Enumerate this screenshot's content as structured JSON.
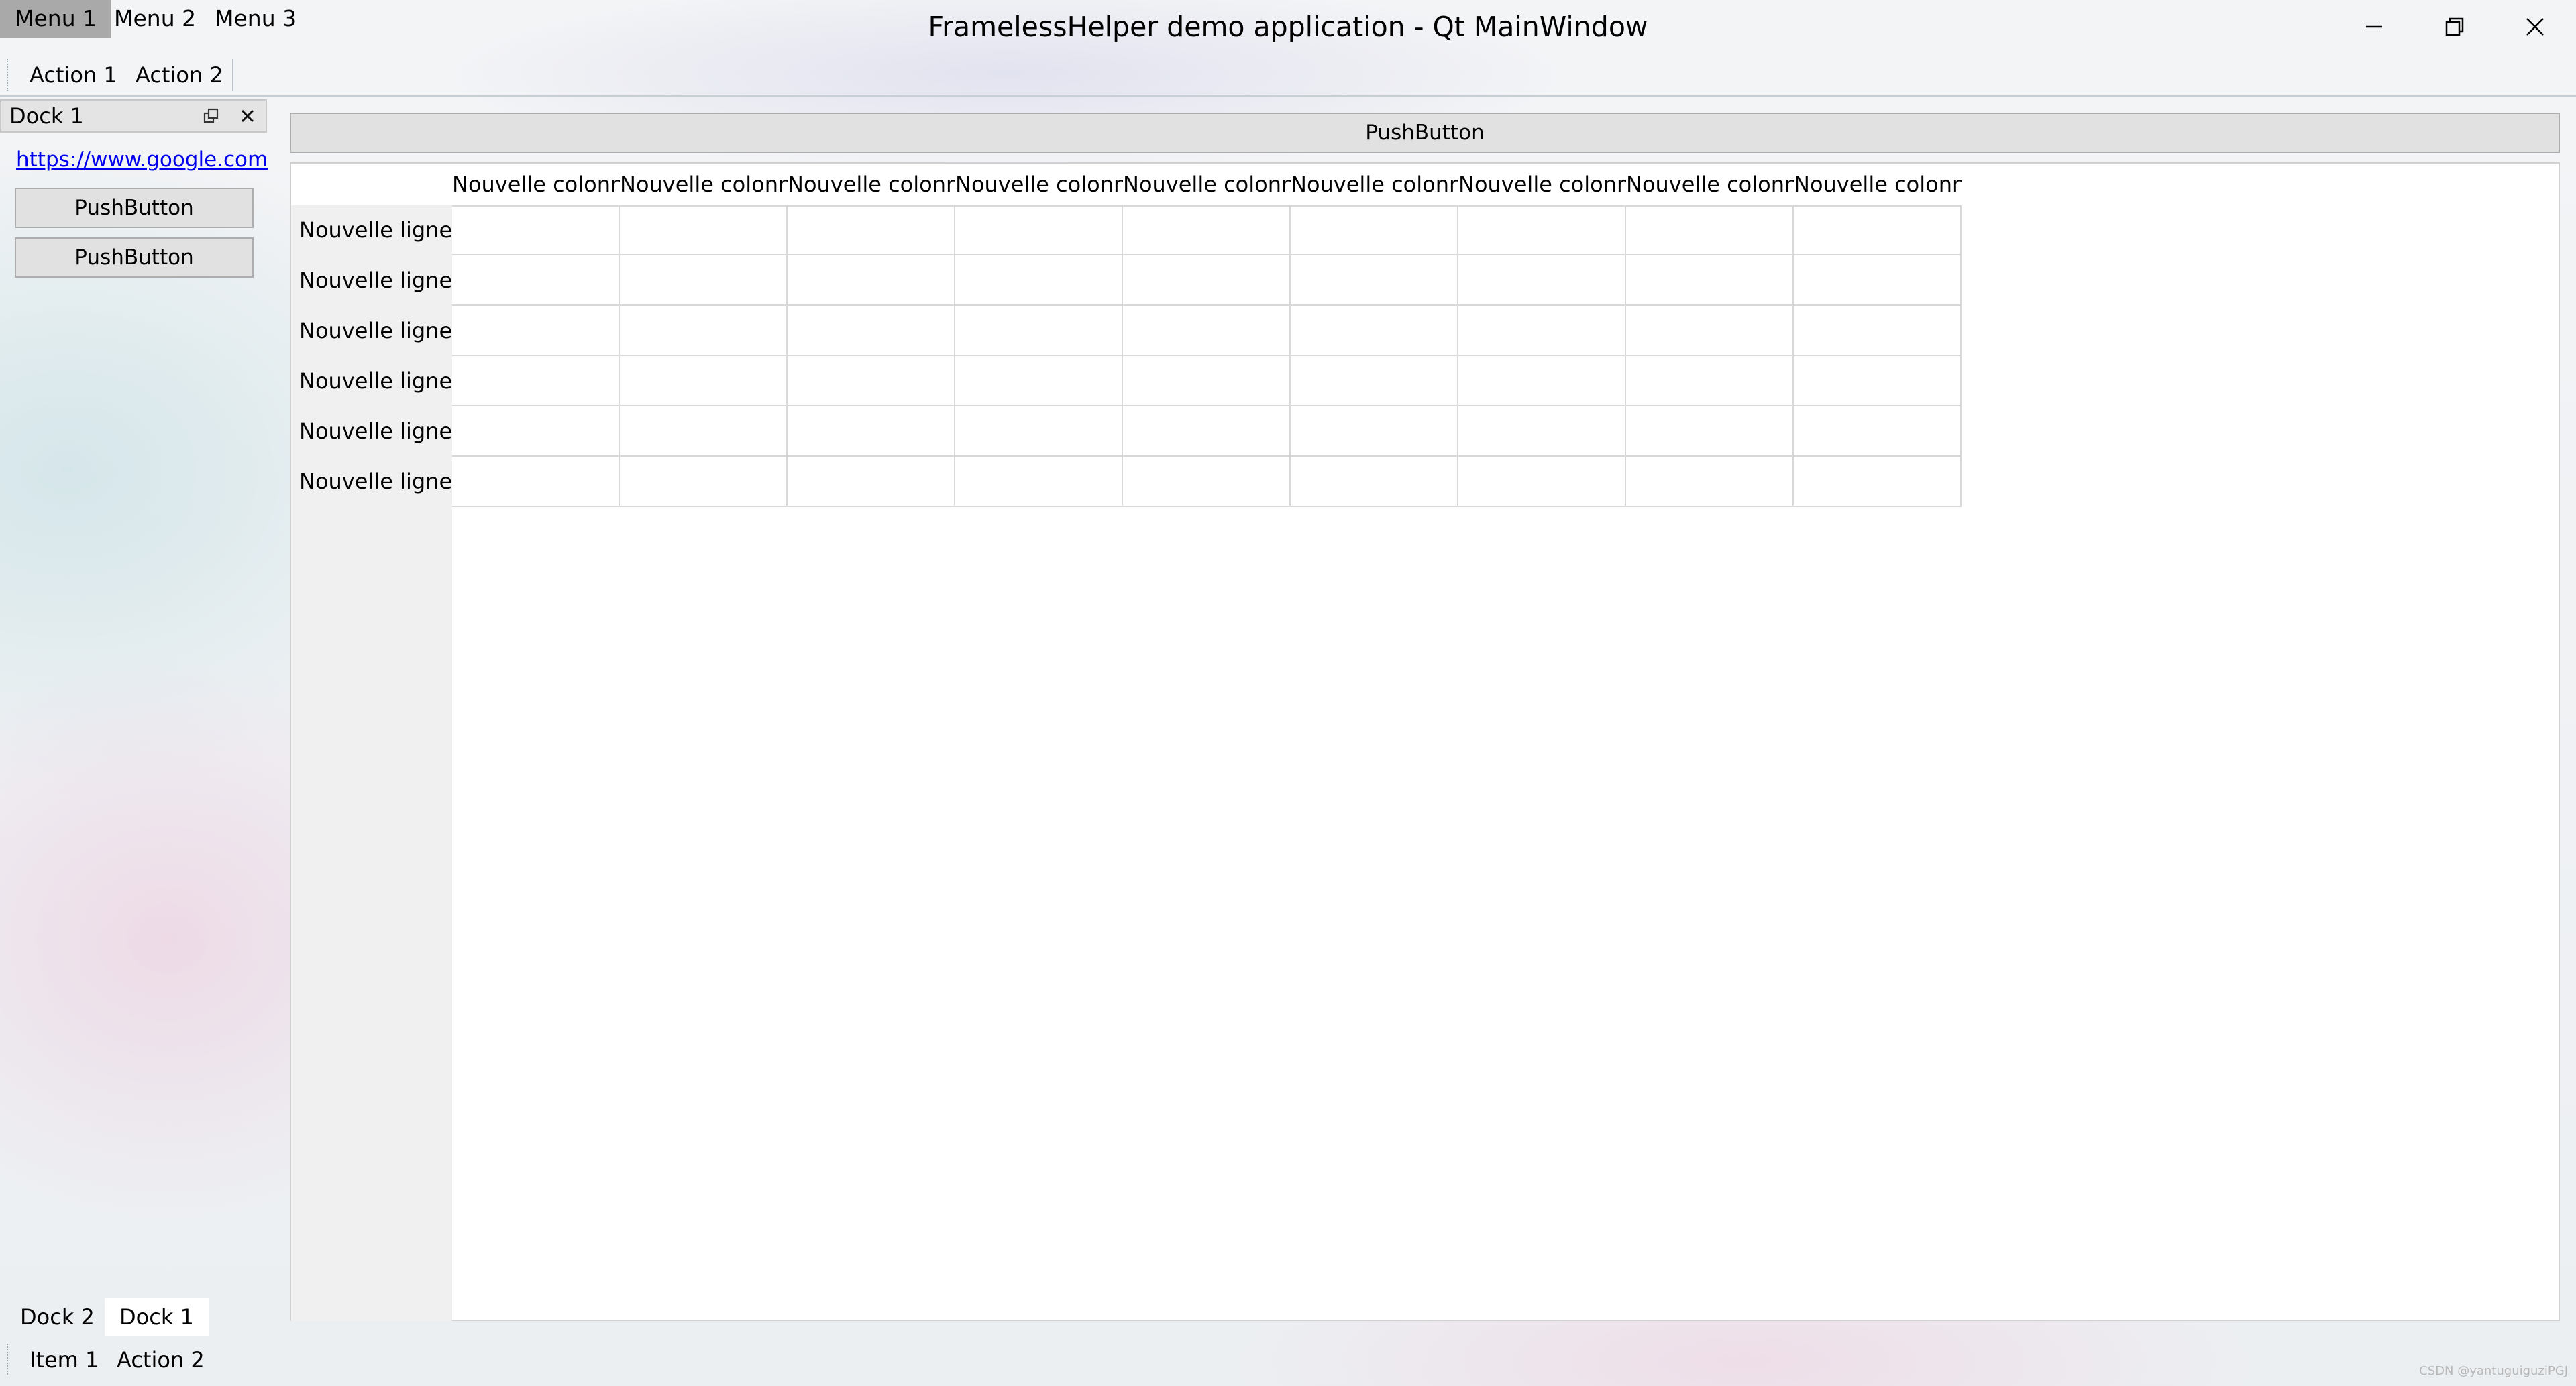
{
  "window": {
    "title": "FramelessHelper demo application - Qt MainWindow",
    "menus": [
      "Menu 1",
      "Menu 2",
      "Menu 3"
    ]
  },
  "toolbar": {
    "actions": [
      "Action 1",
      "Action 2"
    ]
  },
  "dock": {
    "title": "Dock 1",
    "link": "https://www.google.com",
    "buttons": [
      "PushButton",
      "PushButton"
    ],
    "tabs": [
      "Dock 2",
      "Dock 1"
    ],
    "active_tab": "Dock 1"
  },
  "central": {
    "push_button": "PushButton",
    "table": {
      "columns": [
        "Nouvelle colonne",
        "Nouvelle colonne",
        "Nouvelle colonne",
        "Nouvelle colonne",
        "Nouvelle colonne",
        "Nouvelle colonne",
        "Nouvelle colonne",
        "Nouvelle colonne",
        "Nouvelle colonne"
      ],
      "rows": [
        "Nouvelle ligne",
        "Nouvelle ligne",
        "Nouvelle ligne",
        "Nouvelle ligne",
        "Nouvelle ligne",
        "Nouvelle ligne"
      ]
    }
  },
  "bottom_toolbar": {
    "items": [
      "Item 1",
      "Action 2"
    ]
  },
  "watermark": "CSDN @yantuguiguziPGJ"
}
